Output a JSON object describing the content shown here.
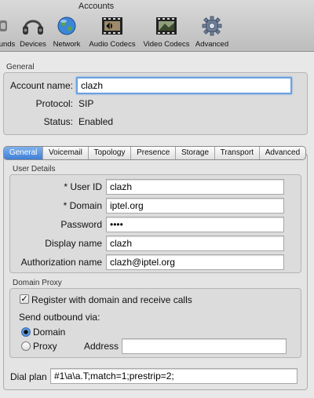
{
  "window": {
    "title": "Accounts"
  },
  "toolbar": {
    "items": [
      {
        "label": "unds",
        "icon": "sounds-icon"
      },
      {
        "label": "Devices",
        "icon": "headset-icon"
      },
      {
        "label": "Network",
        "icon": "globe-icon"
      },
      {
        "label": "Audio Codecs",
        "icon": "audio-film-icon"
      },
      {
        "label": "Video Codecs",
        "icon": "video-film-icon"
      },
      {
        "label": "Advanced",
        "icon": "gear-icon"
      }
    ]
  },
  "general": {
    "section_label": "General",
    "account_name_label": "Account name:",
    "account_name_value": "clazh",
    "protocol_label": "Protocol:",
    "protocol_value": "SIP",
    "status_label": "Status:",
    "status_value": "Enabled"
  },
  "tabs": [
    {
      "label": "General",
      "active": true
    },
    {
      "label": "Voicemail"
    },
    {
      "label": "Topology"
    },
    {
      "label": "Presence"
    },
    {
      "label": "Storage"
    },
    {
      "label": "Transport"
    },
    {
      "label": "Advanced"
    }
  ],
  "user_details": {
    "section_label": "User Details",
    "user_id_label": "* User ID",
    "user_id_value": "clazh",
    "domain_label": "* Domain",
    "domain_value": "iptel.org",
    "password_label": "Password",
    "password_value": "••••",
    "display_name_label": "Display name",
    "display_name_value": "clazh",
    "auth_name_label": "Authorization name",
    "auth_name_value": "clazh@iptel.org"
  },
  "domain_proxy": {
    "section_label": "Domain Proxy",
    "register_label": "Register with domain and receive calls",
    "register_checked": true,
    "send_outbound_label": "Send outbound via:",
    "option_domain_label": "Domain",
    "option_proxy_label": "Proxy",
    "selected_option": "Domain",
    "address_label": "Address",
    "address_value": ""
  },
  "dial_plan": {
    "label": "Dial plan",
    "value": "#1\\a\\a.T;match=1;prestrip=2;"
  },
  "colors": {
    "active_tab": "#3f7fd6",
    "focus_ring": "#6aa1e2",
    "background": "#e8e8e8"
  }
}
